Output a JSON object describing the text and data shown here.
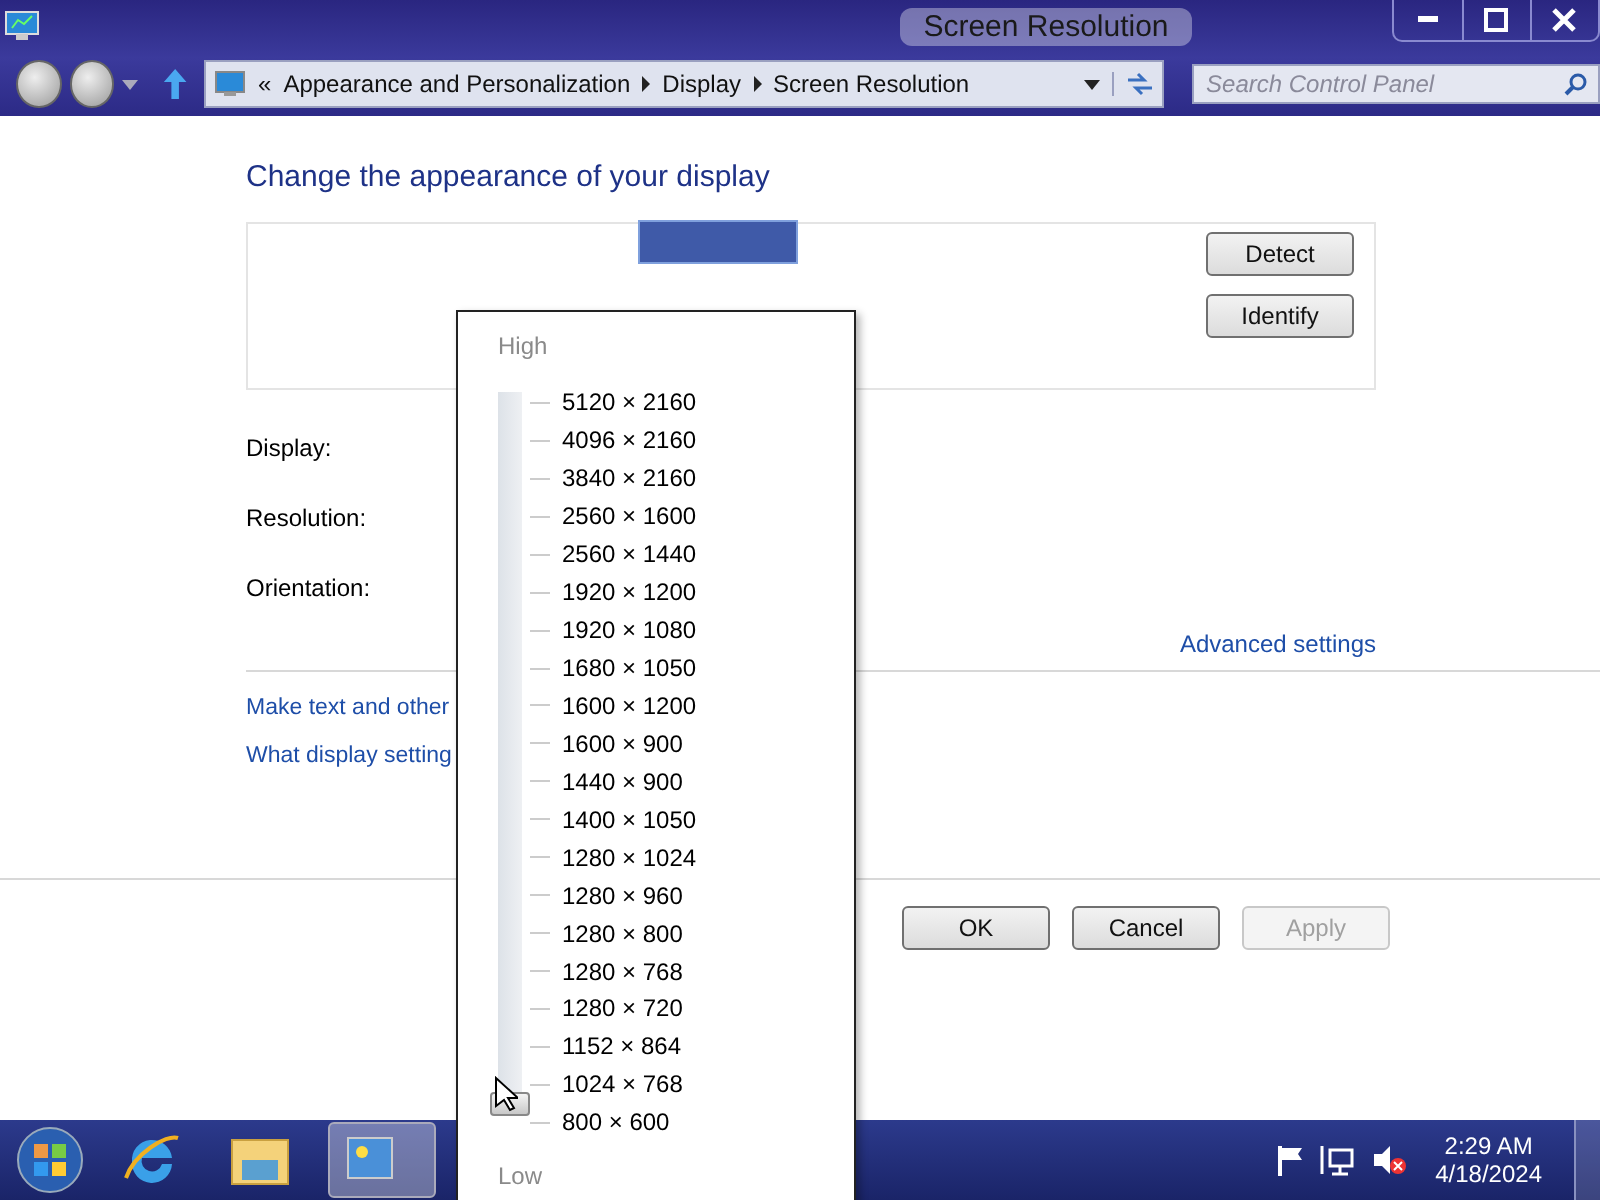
{
  "window": {
    "title": "Screen Resolution"
  },
  "address_bar": {
    "overflow": "«",
    "crumbs": [
      "Appearance and Personalization",
      "Display",
      "Screen Resolution"
    ]
  },
  "search": {
    "placeholder": "Search Control Panel"
  },
  "heading": "Change the appearance of your display",
  "preview_buttons": [
    {
      "label": "Detect"
    },
    {
      "label": "Identify"
    }
  ],
  "fields": [
    "Display:",
    "Resolution:",
    "Orientation:"
  ],
  "advanced_link": "Advanced settings",
  "links": [
    "Make text and other",
    "What display setting"
  ],
  "dialog_buttons": [
    {
      "label": "OK",
      "disabled": false
    },
    {
      "label": "Cancel",
      "disabled": false
    },
    {
      "label": "Apply",
      "disabled": true
    }
  ],
  "resolution_popup": {
    "high_label": "High",
    "low_label": "Low",
    "level": 0,
    "options": [
      "5120 × 2160",
      "4096 × 2160",
      "3840 × 2160",
      "2560 × 1600",
      "2560 × 1440",
      "1920 × 1200",
      "1920 × 1080",
      "1680 × 1050",
      "1600 × 1200",
      "1600 × 900",
      "1440 × 900",
      "1400 × 1050",
      "1280 × 1024",
      "1280 × 960",
      "1280 × 800",
      "1280 × 768",
      "1280 × 720",
      "1152 × 864",
      "1024 × 768",
      "800 × 600"
    ]
  },
  "taskbar": {
    "time": "2:29 AM",
    "date": "4/18/2024"
  }
}
